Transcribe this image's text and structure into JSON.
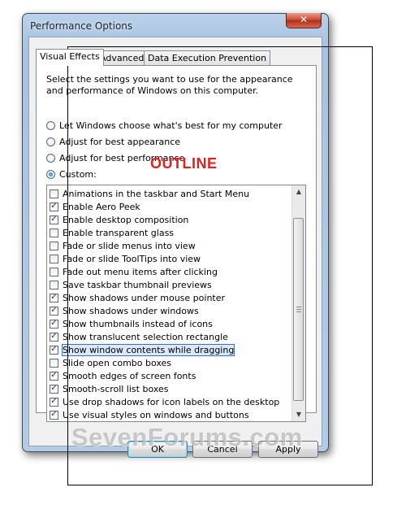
{
  "window": {
    "title": "Performance Options",
    "close_glyph": "✕"
  },
  "tabs": [
    {
      "label": "Visual Effects",
      "active": true
    },
    {
      "label": "Advanced",
      "active": false
    },
    {
      "label": "Data Execution Prevention",
      "active": false
    }
  ],
  "description": "Select the settings you want to use for the appearance and performance of Windows on this computer.",
  "radio_options": [
    {
      "label": "Let Windows choose what's best for my computer",
      "checked": false
    },
    {
      "label": "Adjust for best appearance",
      "checked": false
    },
    {
      "label": "Adjust for best performance",
      "checked": false
    },
    {
      "label": "Custom:",
      "checked": true
    }
  ],
  "annotation": "OUTLINE",
  "effects": [
    {
      "label": "Animations in the taskbar and Start Menu",
      "checked": false
    },
    {
      "label": "Enable Aero Peek",
      "checked": true
    },
    {
      "label": "Enable desktop composition",
      "checked": true
    },
    {
      "label": "Enable transparent glass",
      "checked": false
    },
    {
      "label": "Fade or slide menus into view",
      "checked": false
    },
    {
      "label": "Fade or slide ToolTips into view",
      "checked": false
    },
    {
      "label": "Fade out menu items after clicking",
      "checked": false
    },
    {
      "label": "Save taskbar thumbnail previews",
      "checked": false
    },
    {
      "label": "Show shadows under mouse pointer",
      "checked": true
    },
    {
      "label": "Show shadows under windows",
      "checked": true
    },
    {
      "label": "Show thumbnails instead of icons",
      "checked": true
    },
    {
      "label": "Show translucent selection rectangle",
      "checked": true
    },
    {
      "label": "Show window contents while dragging",
      "checked": true,
      "selected": true
    },
    {
      "label": "Slide open combo boxes",
      "checked": false
    },
    {
      "label": "Smooth edges of screen fonts",
      "checked": true
    },
    {
      "label": "Smooth-scroll list boxes",
      "checked": true
    },
    {
      "label": "Use drop shadows for icon labels on the desktop",
      "checked": true
    },
    {
      "label": "Use visual styles on windows and buttons",
      "checked": true
    }
  ],
  "buttons": {
    "ok": "OK",
    "cancel": "Cancel",
    "apply": "Apply"
  },
  "watermark": "SevenForums.com",
  "icons": {
    "check": "✓",
    "scroll_up": "▲",
    "scroll_down": "▼"
  },
  "colors": {
    "annotation": "#e02222",
    "title_bar": "#b9d1ea",
    "selection_outline": "#3b6fbf"
  }
}
